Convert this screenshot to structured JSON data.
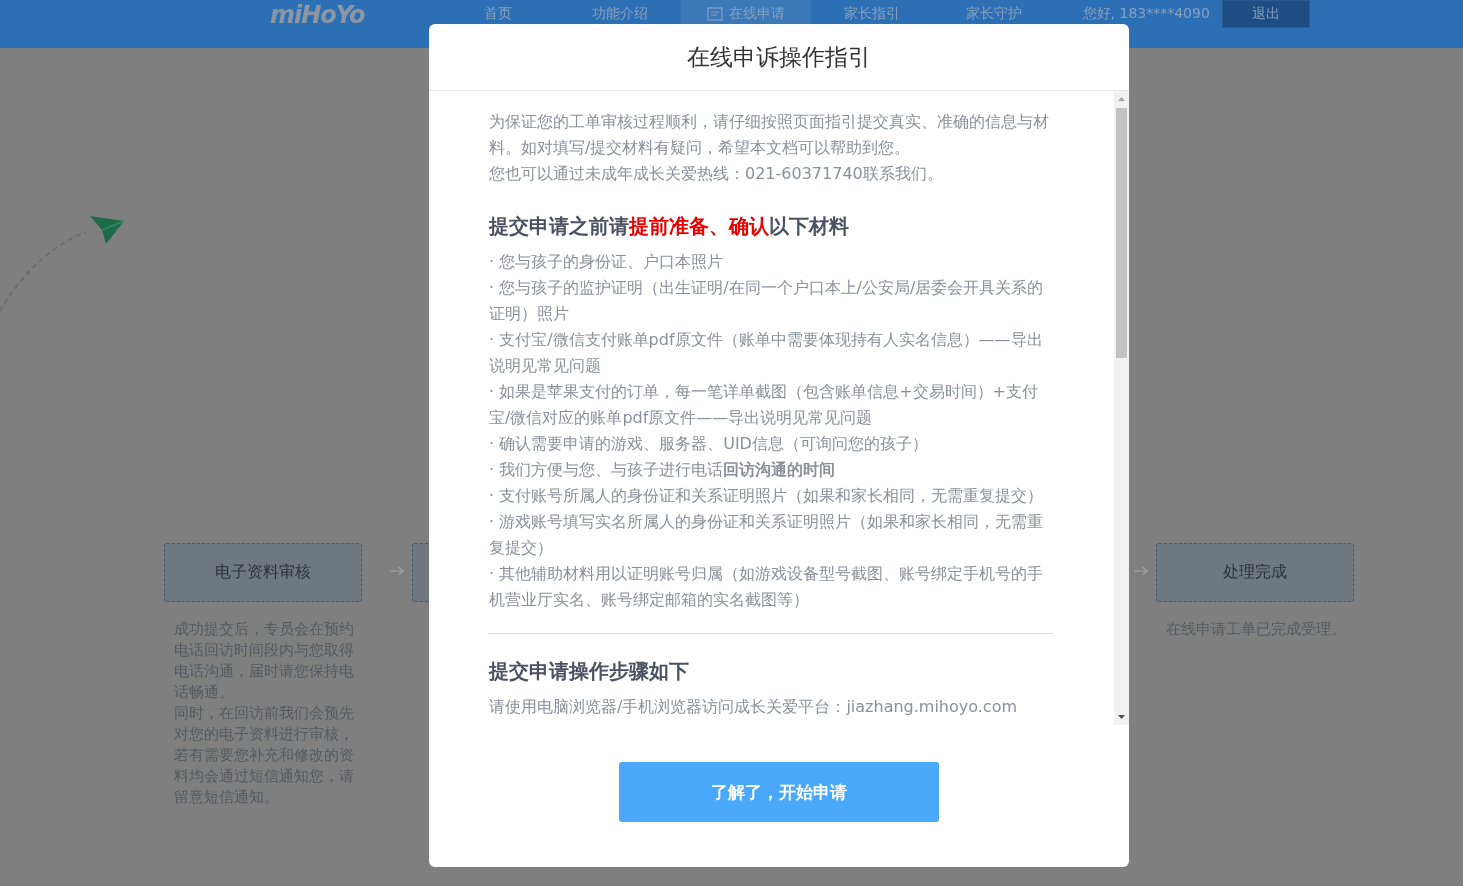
{
  "nav": {
    "logo": "miHoYo",
    "items": [
      {
        "label": "首页",
        "selected": false
      },
      {
        "label": "功能介绍",
        "selected": false
      },
      {
        "label": "在线申请",
        "selected": true
      },
      {
        "label": "家长指引",
        "selected": false
      },
      {
        "label": "家长守护",
        "selected": false
      }
    ],
    "greeting": "您好, 183****4090",
    "logout": "退出"
  },
  "steps": [
    {
      "title": "电子资料审核",
      "description": [
        "成功提交后，专员会在预约电话回访时间段内与您取得电话沟通，届时请您保持电话畅通。",
        "同时，在回访前我们会预先对您的电子资料进行审核，若有需要您补充和修改的资料均会通过短信通知您，请留意短信通知。"
      ]
    },
    {
      "title": "处理完成",
      "description": [
        "在线申请工单已完成受理。"
      ]
    }
  ],
  "dialog": {
    "title": "在线申诉操作指引",
    "intro": [
      "为保证您的工单审核过程顺利，请仔细按照页面指引提交真实、准确的信息与材料。如对填写/提交材料有疑问，希望本文档可以帮助到您。",
      "您也可以通过未成年成长关爱热线：021-60371740联系我们。"
    ],
    "materials_heading": [
      {
        "text": "提交申请之前请",
        "highlight": false
      },
      {
        "text": "提前准备、确认",
        "highlight": true
      },
      {
        "text": "以下材料",
        "highlight": false
      }
    ],
    "materials": [
      "· 您与孩子的身份证、户口本照片",
      "· 您与孩子的监护证明（出生证明/在同一个户口本上/公安局/居委会开具关系的证明）照片",
      "· 支付宝/微信支付账单pdf原文件（账单中需要体现持有人实名信息）——导出说明见常见问题",
      "· 如果是苹果支付的订单，每一笔详单截图（包含账单信息+交易时间）+支付宝/微信对应的账单pdf原文件——导出说明见常见问题",
      "· 确认需要申请的游戏、服务器、UID信息（可询问您的孩子）",
      "· 我们方便与您、与孩子进行电话**回访沟通的时间**",
      "· 支付账号所属人的身份证和关系证明照片（如果和家长相同，无需重复提交）",
      "· 游戏账号填写实名所属人的身份证和关系证明照片（如果和家长相同，无需重复提交）",
      "· 其他辅助材料用以证明账号归属（如游戏设备型号截图、账号绑定手机号的手机营业厅实名、账号绑定邮箱的实名截图等）"
    ],
    "steps_heading": "提交申请操作步骤如下",
    "steps_text": "请使用电脑浏览器/手机浏览器访问成长关爱平台：jiazhang.mihoyo.com",
    "confirm_button": "了解了，开始申请"
  }
}
